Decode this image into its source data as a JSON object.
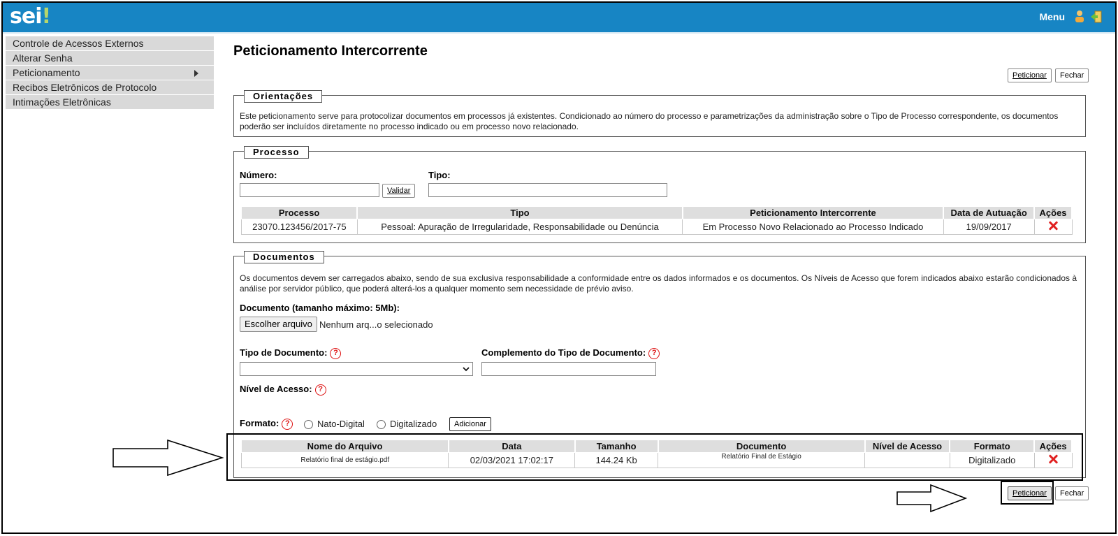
{
  "app": {
    "logo_text": "sei",
    "logo_mark": "!",
    "menu_label": "Menu"
  },
  "sidebar": {
    "items": [
      {
        "label": "Controle de Acessos Externos"
      },
      {
        "label": "Alterar Senha"
      },
      {
        "label": "Peticionamento",
        "has_submenu": true
      },
      {
        "label": "Recibos Eletrônicos de Protocolo"
      },
      {
        "label": "Intimações Eletrônicas"
      }
    ]
  },
  "page": {
    "title": "Peticionamento Intercorrente"
  },
  "toolbar": {
    "peticionar_label": "Peticionar",
    "fechar_label": "Fechar"
  },
  "orientacoes": {
    "legend": "Orientações",
    "text": "Este peticionamento serve para protocolizar documentos em processos já existentes. Condicionado ao número do processo e parametrizações da administração sobre o Tipo de Processo correspondente, os documentos poderão ser incluídos diretamente no processo indicado ou em processo novo relacionado."
  },
  "processo": {
    "legend": "Processo",
    "numero_label": "Número:",
    "numero_value": "",
    "validar_label": "Validar",
    "tipo_label": "Tipo:",
    "tipo_value": "",
    "table": {
      "headers": [
        "Processo",
        "Tipo",
        "Peticionamento Intercorrente",
        "Data de Autuação",
        "Ações"
      ],
      "rows": [
        [
          "23070.123456/2017-75",
          "Pessoal: Apuração de Irregularidade, Responsabilidade ou Denúncia",
          "Em Processo Novo Relacionado ao Processo Indicado",
          "19/09/2017"
        ]
      ]
    }
  },
  "documentos": {
    "legend": "Documentos",
    "text": "Os documentos devem ser carregados abaixo, sendo de sua exclusiva responsabilidade a conformidade entre os dados informados e os documentos. Os Níveis de Acesso que forem indicados abaixo estarão condicionados à análise por servidor público, que poderá alterá-los a qualquer momento sem necessidade de prévio aviso.",
    "documento_label": "Documento (tamanho máximo: 5Mb):",
    "file_button": "Escolher arquivo",
    "file_status": "Nenhum arq...o selecionado",
    "tipo_documento_label": "Tipo de Documento:",
    "tipo_documento_value": "",
    "complemento_label": "Complemento do Tipo de Documento:",
    "complemento_value": "",
    "nivel_acesso_label": "Nível de Acesso:",
    "formato_label": "Formato:",
    "formato_options": [
      "Nato-Digital",
      "Digitalizado"
    ],
    "adicionar_label": "Adicionar",
    "help_glyph": "?",
    "table": {
      "headers": [
        "Nome do Arquivo",
        "Data",
        "Tamanho",
        "Documento",
        "Nível de Acesso",
        "Formato",
        "Ações"
      ],
      "rows": [
        [
          "Relatório final de estágio.pdf",
          "02/03/2021 17:02:17",
          "144.24 Kb",
          "Relatório Final de Estágio",
          "",
          "Digitalizado"
        ]
      ]
    }
  },
  "colors": {
    "topbar": "#1785c4",
    "sidebar_item": "#d9d9d9",
    "header_cell": "#dedede",
    "delete_icon": "#e02020",
    "help_icon": "#d11111"
  }
}
